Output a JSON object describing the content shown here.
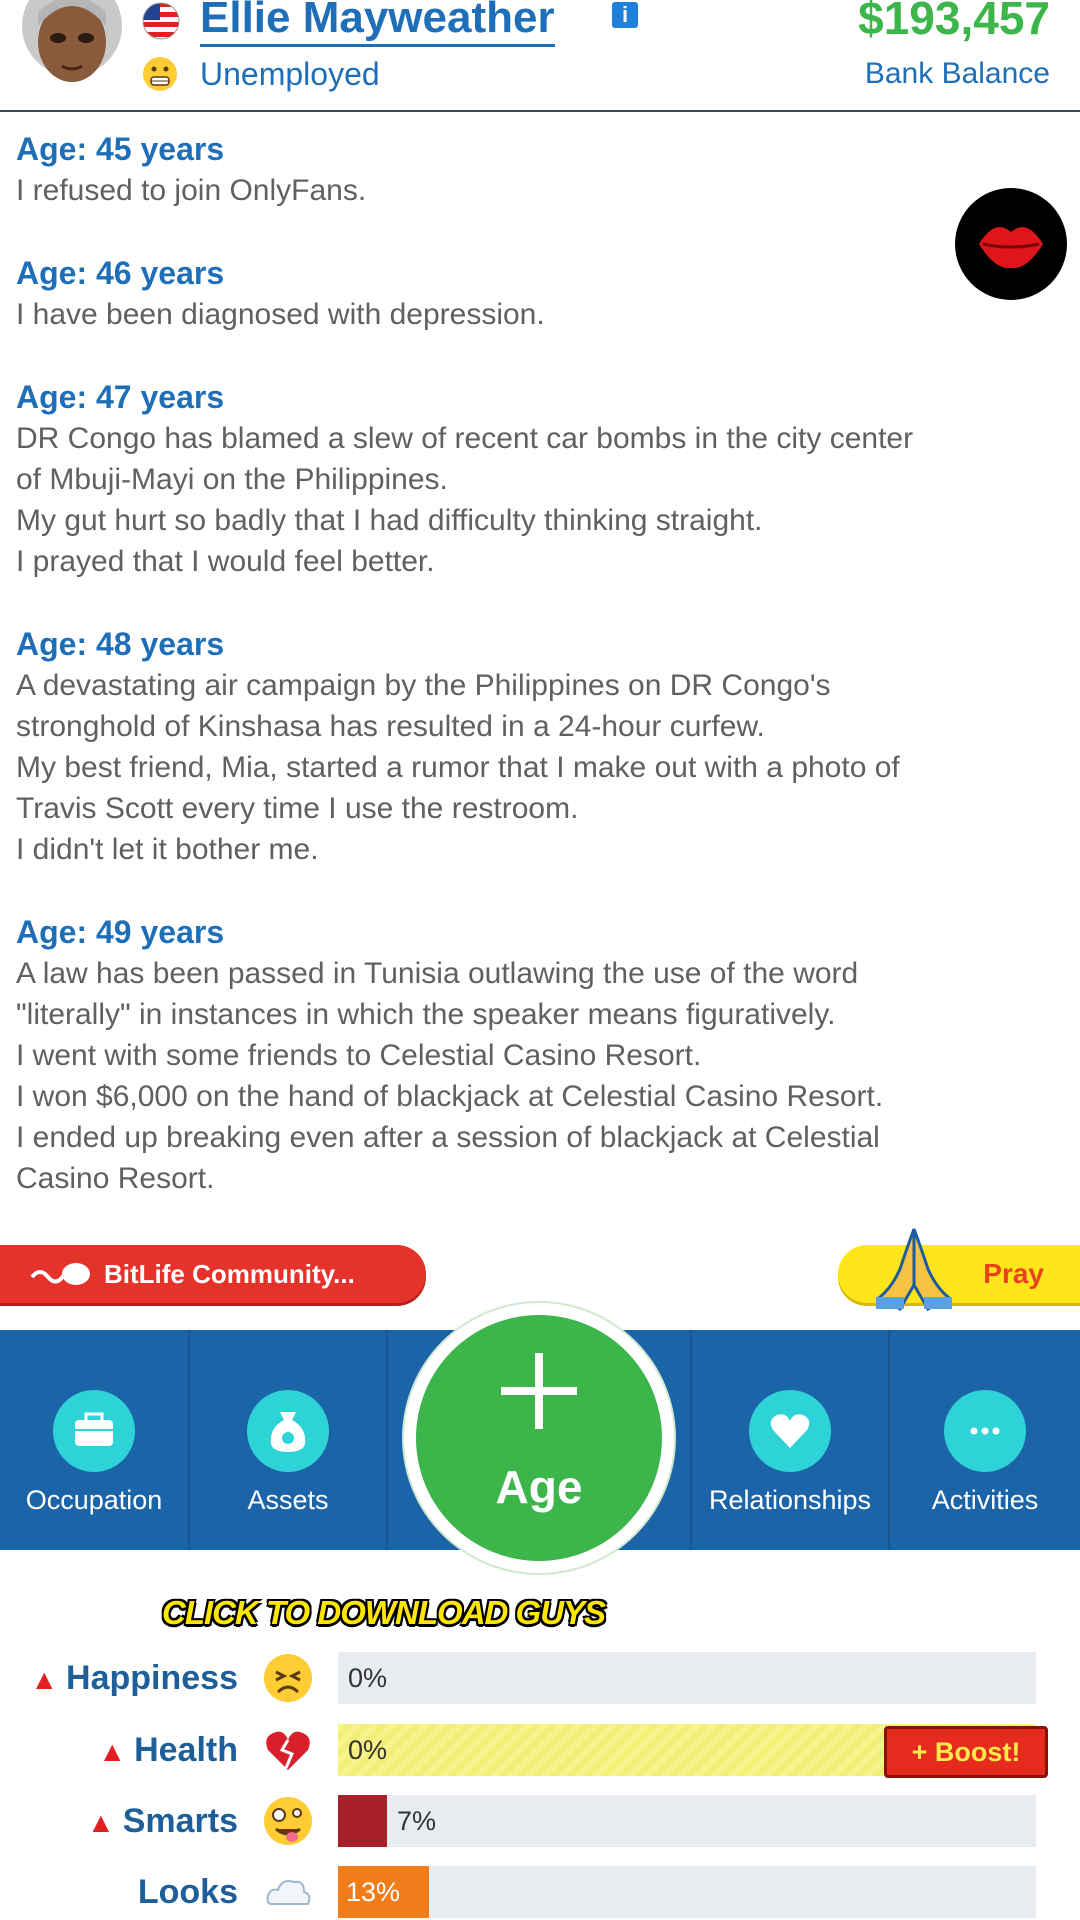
{
  "header": {
    "name": "Ellie Mayweather",
    "info_badge": "i",
    "occupation": "Unemployed",
    "balance": "$193,457",
    "balance_label": "Bank Balance",
    "icons": [
      "avatar",
      "us-flag-icon",
      "info-icon",
      "grimace-emoji-icon"
    ]
  },
  "log": [
    {
      "age": "Age: 45 years",
      "lines": [
        "I refused to join OnlyFans."
      ]
    },
    {
      "age": "Age: 46 years",
      "lines": [
        "I have been diagnosed with depression."
      ]
    },
    {
      "age": "Age: 47 years",
      "lines": [
        "DR Congo has blamed a slew of recent car bombs in the city center",
        "of Mbuji-Mayi on the Philippines.",
        "My gut hurt so badly that I had difficulty thinking straight.",
        "I prayed that I would feel better."
      ]
    },
    {
      "age": "Age: 48 years",
      "lines": [
        "A devastating air campaign by the Philippines on DR Congo's",
        "stronghold of Kinshasa has resulted in a 24-hour curfew.",
        "My best friend, Mia, started a rumor that I make out with a photo of",
        "Travis Scott every time I use the restroom.",
        "I didn't let it bother me."
      ]
    },
    {
      "age": "Age: 49 years",
      "lines": [
        "A law has been passed in Tunisia outlawing the use of the word",
        "\"literally\" in instances in which the speaker means figuratively.",
        "I went with some friends to Celestial Casino Resort.",
        "I won $6,000 on the hand of blackjack at Celestial Casino Resort.",
        "I ended up breaking even after a session of blackjack at Celestial",
        "Casino Resort."
      ]
    }
  ],
  "actions": {
    "community": "BitLife Community...",
    "pray": "Pray"
  },
  "nav": {
    "occupation": "Occupation",
    "assets": "Assets",
    "age_symbol": "+",
    "age": "Age",
    "relationships": "Relationships",
    "activities": "Activities"
  },
  "promo": "CLICK TO DOWNLOAD GUYS",
  "stats": [
    {
      "label": "Happiness",
      "warning": true,
      "value": 0,
      "text": "0%",
      "color": "#e8ecf0"
    },
    {
      "label": "Health",
      "warning": true,
      "value": 0,
      "text": "0%",
      "color": "#f6f27a"
    },
    {
      "label": "Smarts",
      "warning": true,
      "value": 7,
      "text": "7%",
      "color": "#a8202a"
    },
    {
      "label": "Looks",
      "warning": false,
      "value": 13,
      "text": "13%",
      "color": "#f07d1a"
    }
  ],
  "boost": "+ Boost!",
  "warning_symbol": "▲",
  "colors": {
    "accent_blue": "#1e6fb8",
    "money_green": "#3cb64a",
    "nav_blue": "#1b64a8",
    "age_green": "#3cb54a"
  }
}
